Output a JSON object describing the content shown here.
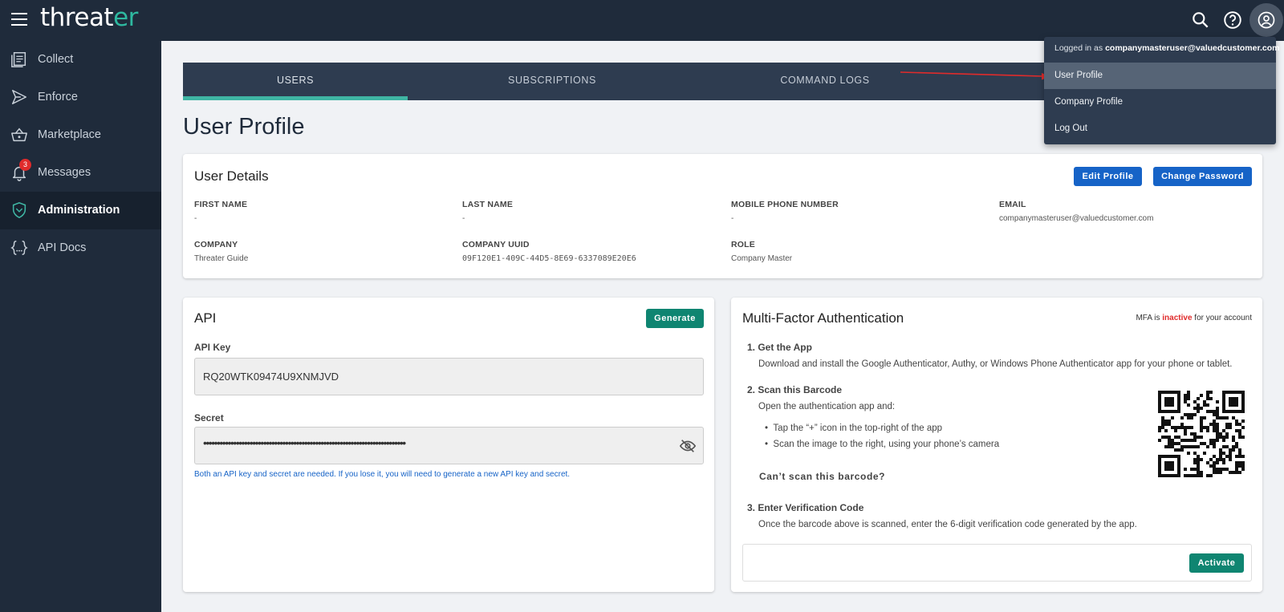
{
  "app": {
    "logo_main": "threat",
    "logo_tail": "er"
  },
  "sidebar": {
    "items": [
      {
        "label": "Collect",
        "icon": "collect-icon"
      },
      {
        "label": "Enforce",
        "icon": "enforce-icon"
      },
      {
        "label": "Marketplace",
        "icon": "basket-icon"
      },
      {
        "label": "Messages",
        "icon": "bell-icon",
        "badge": "3"
      },
      {
        "label": "Administration",
        "icon": "shield-icon",
        "active": true
      },
      {
        "label": "API Docs",
        "icon": "braces-icon"
      }
    ]
  },
  "tabs": [
    {
      "label": "USERS",
      "active": true
    },
    {
      "label": "SUBSCRIPTIONS"
    },
    {
      "label": "COMMAND LOGS"
    }
  ],
  "page": {
    "title": "User Profile"
  },
  "user_details": {
    "title": "User Details",
    "edit_label": "Edit Profile",
    "change_password_label": "Change Password",
    "fields": {
      "first_name": {
        "label": "FIRST NAME",
        "value": "-"
      },
      "last_name": {
        "label": "LAST NAME",
        "value": "-"
      },
      "mobile": {
        "label": "MOBILE PHONE NUMBER",
        "value": "-"
      },
      "email": {
        "label": "EMAIL",
        "value": "companymasteruser@valuedcustomer.com"
      },
      "company": {
        "label": "COMPANY",
        "value": "Threater Guide"
      },
      "uuid": {
        "label": "COMPANY UUID",
        "value": "09F120E1-409C-44D5-8E69-6337089E20E6"
      },
      "role": {
        "label": "ROLE",
        "value": "Company Master"
      }
    }
  },
  "api": {
    "title": "API",
    "generate_label": "Generate",
    "key_label": "API Key",
    "key_value": "RQ20WTK09474U9XNMJVD",
    "secret_label": "Secret",
    "secret_value": "••••••••••••••••••••••••••••••••••••••••••••••••••••••••••••••••••••••••••",
    "help_text": "Both an API key and secret are needed. If you lose it, you will need to generate a new API key and secret."
  },
  "mfa": {
    "title": "Multi-Factor Authentication",
    "status_prefix": "MFA is ",
    "status_value": "inactive",
    "status_suffix": " for your account",
    "status_color": "#e02b2b",
    "step1_title": "1. Get the App",
    "step1_text": "Download and install the Google Authenticator, Authy, or Windows Phone Authenticator app for your phone or tablet.",
    "step2_title": "2. Scan this Barcode",
    "step2_text": "Open the authentication app and:",
    "bullet1": "Tap the “+” icon in the top-right of the app",
    "bullet2": "Scan the image to the right, using your phone’s camera",
    "cant_scan": "Can’t scan this barcode?",
    "step3_title": "3. Enter Verification Code",
    "step3_text": "Once the barcode above is scanned, enter the 6-digit verification code generated by the app.",
    "activate_label": "Activate"
  },
  "user_menu": {
    "logged_in_prefix": "Logged in as ",
    "logged_in_user": "companymasteruser@valuedcustomer.com",
    "items": [
      {
        "label": "User Profile",
        "highlighted": true
      },
      {
        "label": "Company Profile"
      },
      {
        "label": "Log Out"
      }
    ]
  }
}
